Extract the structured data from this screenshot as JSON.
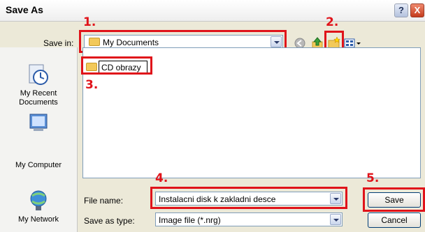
{
  "dialog": {
    "title": "Save As",
    "help_icon": "?",
    "close_icon": "X"
  },
  "save_in": {
    "label": "Save in:",
    "value": "My Documents"
  },
  "toolbar": {
    "icons": [
      "back-icon",
      "up-one-level-icon",
      "create-new-folder-icon",
      "views-menu-icon"
    ]
  },
  "places": {
    "items": [
      {
        "label": "My Recent\nDocuments",
        "icon": "recent-documents-icon"
      },
      {
        "label": "",
        "icon": "desktop-icon"
      },
      {
        "label": "My Computer",
        "icon": "my-computer-icon"
      },
      {
        "label": "My Network",
        "icon": "my-network-icon"
      }
    ]
  },
  "files": {
    "new_folder_name": "CD obrazy"
  },
  "file_name": {
    "label": "File name:",
    "value": "Instalacni disk k zakladni desce"
  },
  "save_as_type": {
    "label": "Save as type:",
    "value": "Image file (*.nrg)"
  },
  "buttons": {
    "save": "Save",
    "cancel": "Cancel"
  },
  "annotations": [
    "1.",
    "2.",
    "3.",
    "4.",
    "5."
  ],
  "colors": {
    "highlight_red": "#e0131a",
    "dialog_bg": "#ece9d8"
  }
}
